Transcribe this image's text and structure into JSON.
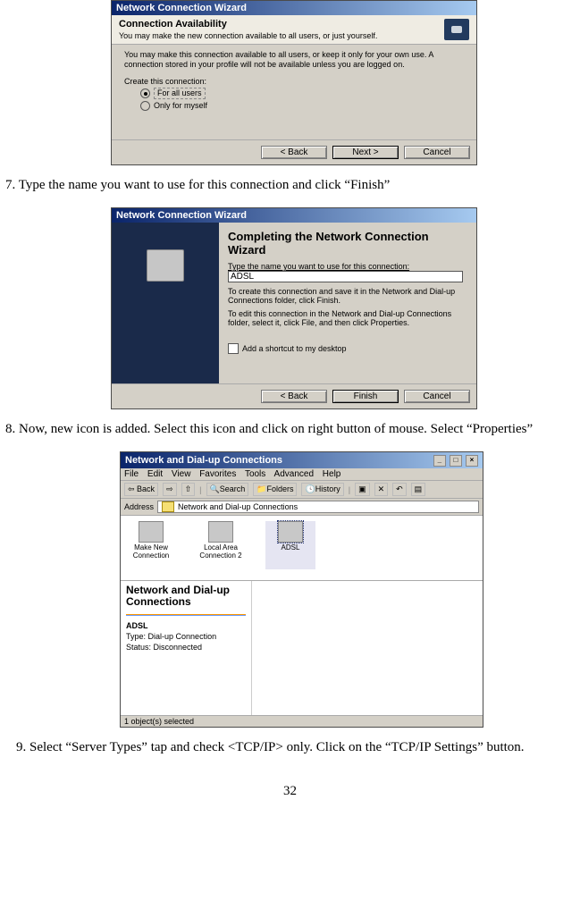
{
  "page_number": "32",
  "steps": {
    "s7": "7. Type the name you want to use for this connection and click “Finish”",
    "s8": "8. Now, new icon is added. Select this icon and click on right button of mouse. Select “Properties”",
    "s9": "9. Select “Server Types” tap and check <TCP/IP> only. Click on the “TCP/IP Settings” button."
  },
  "dlg1": {
    "title": "Network Connection Wizard",
    "header": "Connection Availability",
    "subheader": "You may make the new connection available to all users, or just yourself.",
    "desc": "You may make this connection available to all users, or keep it only for your own use. A connection stored in your profile will not be available unless you are logged on.",
    "create_label": "Create this connection:",
    "opt1": "For all users",
    "opt2": "Only for myself",
    "back": "< Back",
    "next": "Next >",
    "cancel": "Cancel"
  },
  "dlg2": {
    "title": "Network Connection Wizard",
    "heading": "Completing the Network Connection Wizard",
    "label": "Type the name you want to use for this connection:",
    "value": "ADSL",
    "p1": "To create this connection and save it in the Network and Dial-up Connections folder, click Finish.",
    "p2": "To edit this connection in the Network and Dial-up Connections folder, select it, click File, and then click Properties.",
    "chk": "Add a shortcut to my desktop",
    "back": "< Back",
    "finish": "Finish",
    "cancel": "Cancel"
  },
  "win3": {
    "title": "Network and Dial-up Connections",
    "menu": {
      "file": "File",
      "edit": "Edit",
      "view": "View",
      "favorites": "Favorites",
      "tools": "Tools",
      "advanced": "Advanced",
      "help": "Help"
    },
    "tb": {
      "back": "Back",
      "search": "Search",
      "folders": "Folders",
      "history": "History"
    },
    "address_label": "Address",
    "address_value": "Network and Dial-up Connections",
    "icons": {
      "makenew": "Make New Connection",
      "lan": "Local Area Connection 2",
      "adsl": "ADSL"
    },
    "left": {
      "title": "Network and Dial-up Connections",
      "name": "ADSL",
      "type_label": "Type:",
      "type_value": "Dial-up Connection",
      "status_label": "Status:",
      "status_value": "Disconnected"
    },
    "statusbar": "1 object(s) selected"
  }
}
